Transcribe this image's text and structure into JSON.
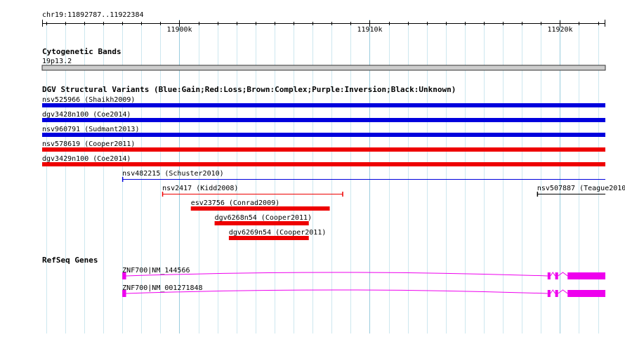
{
  "browser": {
    "location": "chr19:11892787..11922384",
    "ruler": {
      "start": 11892787,
      "end": 11922384,
      "major_ticks": [
        {
          "pos": 11900000,
          "label": "11900k"
        },
        {
          "pos": 11910000,
          "label": "11910k"
        },
        {
          "pos": 11920000,
          "label": "11920k"
        }
      ]
    }
  },
  "tracks": {
    "cytoband": {
      "title": "Cytogenetic Bands",
      "band_label": "19p13.2",
      "band_color": "#cccccc"
    },
    "dgv": {
      "title": "DGV Structural Variants (Blue:Gain;Red:Loss;Brown:Complex;Purple:Inversion;Black:Unknown)",
      "colors": {
        "gain": "#0000dd",
        "loss": "#ee0000"
      },
      "features": [
        {
          "label": "nsv525966 (Shaikh2009)",
          "start": 11892787,
          "end": 11922384,
          "type": "gain",
          "style": "thick"
        },
        {
          "label": "dgv3428n100 (Coe2014)",
          "start": 11892787,
          "end": 11922384,
          "type": "gain",
          "style": "thick"
        },
        {
          "label": "nsv960791 (Sudmant2013)",
          "start": 11892787,
          "end": 11922384,
          "type": "gain",
          "style": "thick"
        },
        {
          "label": "nsv578619 (Cooper2011)",
          "start": 11892787,
          "end": 11922384,
          "type": "loss",
          "style": "thick"
        },
        {
          "label": "dgv3429n100 (Coe2014)",
          "start": 11892787,
          "end": 11922384,
          "type": "loss",
          "style": "thick"
        },
        {
          "label": "nsv482215 (Schuster2010)",
          "start": 11897000,
          "end": 11922384,
          "type": "gain",
          "style": "thin"
        },
        {
          "label": "nsv2417 (Kidd2008)",
          "start": 11899100,
          "end": 11908600,
          "type": "loss",
          "style": "thin"
        },
        {
          "label": "nsv507887 (Teague2010)",
          "start": 11918800,
          "end": 11922384,
          "type": "unknown",
          "style": "thin"
        },
        {
          "label": "esv23756 (Conrad2009)",
          "start": 11900600,
          "end": 11907900,
          "type": "loss",
          "style": "thick"
        },
        {
          "label": "dgv6268n54 (Cooper2011)",
          "start": 11901850,
          "end": 11906800,
          "type": "loss",
          "style": "thick"
        },
        {
          "label": "dgv6269n54 (Cooper2011)",
          "start": 11902600,
          "end": 11906800,
          "type": "loss",
          "style": "thick"
        }
      ]
    },
    "refseq": {
      "title": "RefSeq Genes",
      "color": "#ee00ee",
      "genes": [
        {
          "label": "ZNF700|NM_144566",
          "start": 11897000,
          "end": 11922384,
          "exons": [
            [
              11897000,
              11897200
            ],
            [
              11919350,
              11919500
            ],
            [
              11919750,
              11919900
            ],
            [
              11920400,
              11922384
            ]
          ]
        },
        {
          "label": "ZNF700|NM_001271848",
          "start": 11897000,
          "end": 11922384,
          "exons": [
            [
              11897000,
              11897200
            ],
            [
              11919350,
              11919500
            ],
            [
              11919750,
              11919900
            ],
            [
              11920400,
              11922384
            ]
          ]
        }
      ]
    }
  }
}
